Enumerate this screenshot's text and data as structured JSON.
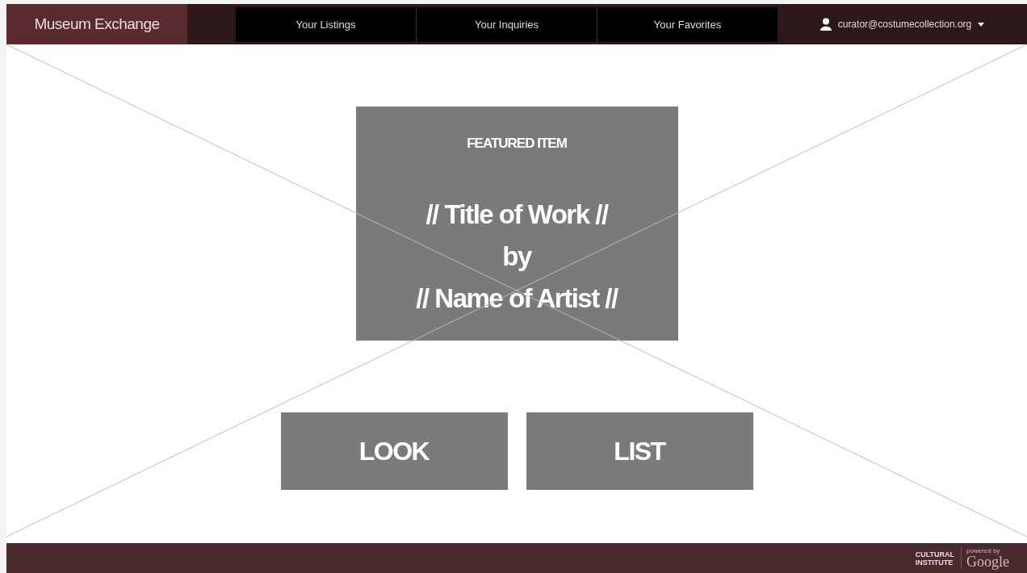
{
  "brand": "Museum Exchange",
  "nav": [
    {
      "label": "Your Listings",
      "selected": false
    },
    {
      "label": "Your Inquiries",
      "selected": false
    },
    {
      "label": "Your Favorites",
      "selected": false
    }
  ],
  "user": {
    "email": "curator@costumecollection.org"
  },
  "featured": {
    "heading": "FEATURED ITEM",
    "lines": [
      "// Title of Work //",
      "by",
      "// Name of Artist //"
    ]
  },
  "actions": [
    "LOOK",
    "LIST"
  ],
  "footer": {
    "logo_lines": [
      "CULTURAL",
      "INSTITUTE"
    ],
    "powered_by": "powered by",
    "google": "Google"
  }
}
